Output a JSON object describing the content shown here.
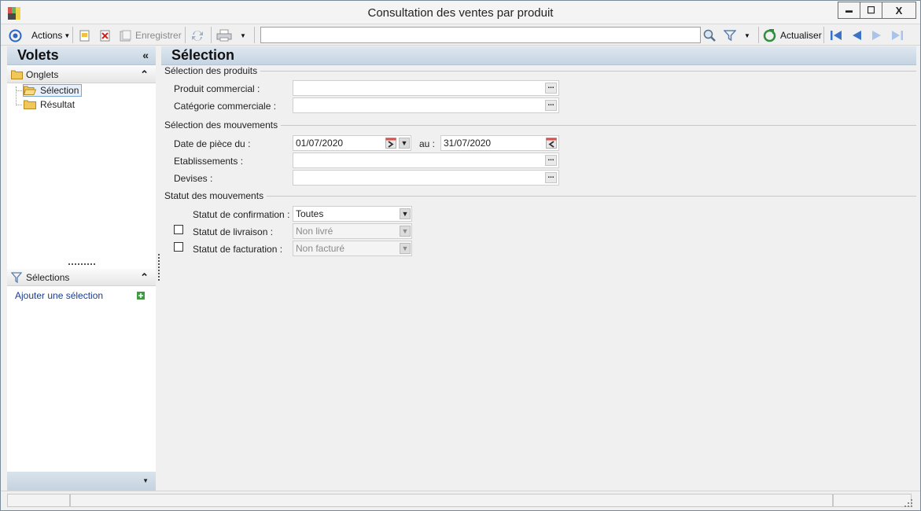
{
  "window": {
    "title": "Consultation des ventes par produit",
    "controls": {
      "minimize": "▬",
      "maximize": "☐",
      "close": "X"
    }
  },
  "toolbar": {
    "actions_label": "Actions",
    "save_label": "Enregistrer",
    "refresh_label": "Actualiser",
    "search_value": ""
  },
  "left_panel": {
    "title": "Volets",
    "collapse_glyph": "«",
    "tabs_section": "Onglets",
    "tree": [
      "Sélection",
      "Résultat"
    ],
    "selections_section": "Sélections",
    "add_selection_link": "Ajouter une sélection"
  },
  "main": {
    "title": "Sélection",
    "groups": {
      "products": "Sélection des produits",
      "movements": "Sélection des mouvements",
      "status": "Statut des mouvements"
    },
    "fields": {
      "produit_commercial": {
        "label": "Produit commercial :",
        "value": ""
      },
      "categorie_commerciale": {
        "label": "Catégorie commerciale :",
        "value": ""
      },
      "date_piece": {
        "label": "Date de pièce du :",
        "from": "01/07/2020",
        "to_label": "au :",
        "to": "31/07/2020"
      },
      "etablissements": {
        "label": "Etablissements :",
        "value": ""
      },
      "devises": {
        "label": "Devises :",
        "value": ""
      },
      "statut_confirmation": {
        "label": "Statut de confirmation :",
        "value": "Toutes"
      },
      "statut_livraison": {
        "label": "Statut de livraison :",
        "value": "Non livré",
        "checked": false
      },
      "statut_facturation": {
        "label": "Statut de facturation :",
        "value": "Non facturé",
        "checked": false
      }
    }
  },
  "colors": {
    "header_gradient": "#c6d4e2",
    "link": "#1a3c8f",
    "accent_blue": "#2a66c8"
  }
}
